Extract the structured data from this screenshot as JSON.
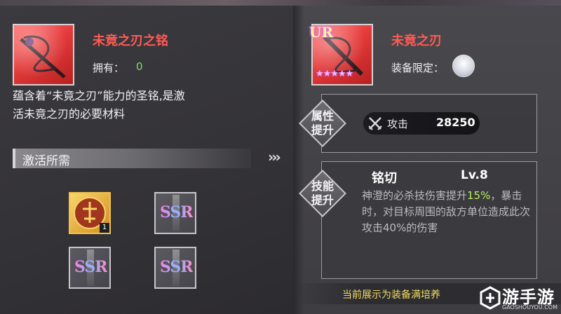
{
  "left": {
    "item_name": "未竟之刃之铭",
    "owned_label": "拥有：",
    "owned_value": "0",
    "description_line1": "蕴含着“未竟之刃”能力的圣铭,是激",
    "description_line2": "活未竟之刃的必要材料",
    "requirement_title": "激活所需",
    "materials": [
      {
        "type": "gold-emblem",
        "count": "1"
      },
      {
        "type": "ssr",
        "label": "SSR"
      },
      {
        "type": "ssr",
        "label": "SSR"
      },
      {
        "type": "ssr",
        "label": "SSR"
      }
    ]
  },
  "right": {
    "rarity_badge": "UR",
    "weapon_name": "未竟之刃",
    "equip_limit_label": "装备限定：",
    "attribute_section": {
      "line1": "属性",
      "line2": "提升"
    },
    "stat": {
      "name": "攻击",
      "value": "28250",
      "icon": "crossed-swords-icon"
    },
    "skill_section": {
      "line1": "技能",
      "line2": "提升"
    },
    "skill": {
      "name": "铭切",
      "level": "Lv.8",
      "desc_part1": "神澄的必杀技伤害提升",
      "desc_highlight": "15%",
      "desc_part2": "，暴击时，对目标周围的敌方单位造成此次攻击40%的伤害"
    },
    "banner_text": "当前展示为装备满培养",
    "star_count": 5
  },
  "watermark": {
    "text": "游手游",
    "sub": "GAOSHOUYOU.COM"
  },
  "colors": {
    "item_name": "#ff5b55",
    "owned_value": "#7fe05e",
    "highlight": "#b6f05a",
    "banner": "#f2dd63"
  }
}
